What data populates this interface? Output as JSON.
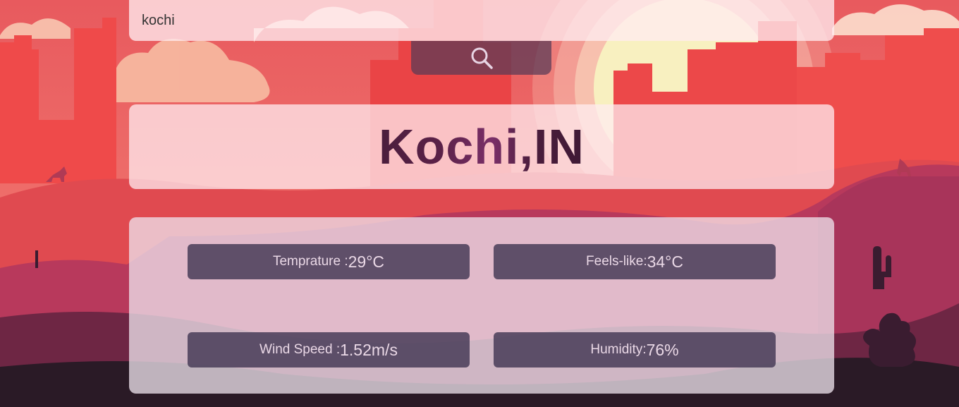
{
  "search": {
    "value": "kochi",
    "button_icon": "search-icon"
  },
  "city": {
    "name": "Kochi,IN"
  },
  "stats": {
    "temperature": {
      "label": "Temprature :",
      "value": "29°C"
    },
    "feels_like": {
      "label": "Feels-like:",
      "value": "34°C"
    },
    "wind_speed": {
      "label": "Wind Speed :",
      "value": "1.52m/s"
    },
    "humidity": {
      "label": "Humidity:",
      "value": "76%"
    }
  },
  "colors": {
    "sky": "#e9484a",
    "sun": "#f8f0c0",
    "mesa": "#ef4a4a",
    "ground_dark": "#2a1a26",
    "stat_box": "#4a3c5a",
    "city_text": "#4a1d3c"
  }
}
